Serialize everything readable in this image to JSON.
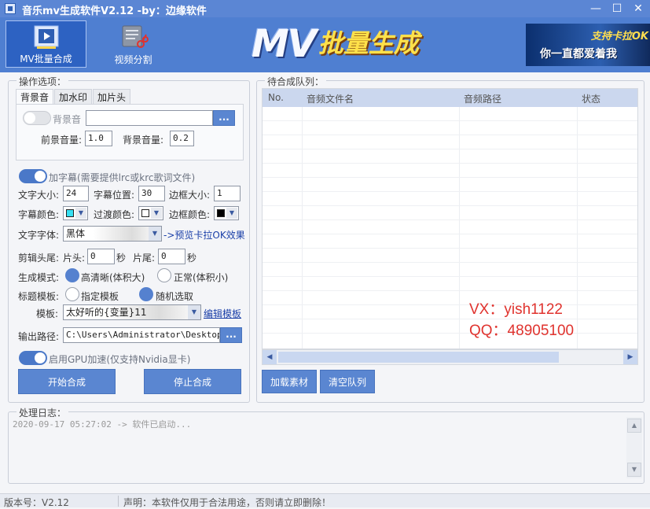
{
  "window": {
    "title": "音乐mv生成软件V2.12 -by：边缘软件",
    "controls": {
      "minimize": "—",
      "maximize": "☐",
      "close": "✕"
    }
  },
  "toolbar": {
    "items": [
      {
        "label": "MV批量合成",
        "icon": "film-icon",
        "active": true
      },
      {
        "label": "视频分割",
        "icon": "video-cut-icon",
        "active": false
      }
    ],
    "logo_mv": "MV",
    "logo_cn": "批量生成",
    "banner_line1": "支持卡拉OK",
    "banner_line2": "你一直都爱着我"
  },
  "options": {
    "group_title": "操作选项：",
    "tabs": [
      "背景音",
      "加水印",
      "加片头"
    ],
    "bgm": {
      "toggle_label": "背景音",
      "path_value": "",
      "browse_label": "...",
      "front_vol_label": "前景音量:",
      "front_vol_value": "1.0",
      "bg_vol_label": "背景音量:",
      "bg_vol_value": "0.2"
    },
    "subtitle": {
      "toggle_label": "加字幕(需要提供lrc或krc歌词文件)",
      "font_size_label": "文字大小:",
      "font_size_value": "24",
      "position_label": "字幕位置:",
      "position_value": "30",
      "border_size_label": "边框大小:",
      "border_size_value": "1",
      "sub_color_label": "字幕颜色:",
      "sub_color": "#36e0f2",
      "transition_color_label": "过渡颜色:",
      "transition_color": "#ffffff",
      "border_color_label": "边框颜色:",
      "border_color": "#000000",
      "font_label": "文字字体:",
      "font_value": "黑体",
      "preview_link": "->预览卡拉OK效果"
    },
    "trim": {
      "label": "剪辑头尾:",
      "head_label": "片头:",
      "head_value": "0",
      "head_unit": "秒",
      "tail_label": "片尾:",
      "tail_value": "0",
      "tail_unit": "秒"
    },
    "mode": {
      "label": "生成模式:",
      "hd_label": "高清晰(体积大)",
      "normal_label": "正常(体积小)"
    },
    "title_template": {
      "label": "标题模板:",
      "specified_label": "指定模板",
      "random_label": "随机选取"
    },
    "template": {
      "label": "模板:",
      "value": "太好听的{变量}11",
      "edit_link": "编辑模板"
    },
    "output": {
      "label": "输出路径:",
      "value": "C:\\Users\\Administrator\\Desktop\\d",
      "browse_label": "..."
    },
    "gpu_label": "启用GPU加速(仅支持Nvidia显卡)",
    "start_button": "开始合成",
    "stop_button": "停止合成"
  },
  "queue": {
    "group_title": "待合成队列：",
    "columns": [
      "No.",
      "音频文件名",
      "音频路径",
      "状态"
    ],
    "rows": [],
    "load_button": "加载素材",
    "clear_button": "清空队列"
  },
  "contact": {
    "vx": "VX：yish1122",
    "qq": "QQ：48905100"
  },
  "log": {
    "group_title": "处理日志：",
    "lines": [
      "2020-09-17 05:27:02 -> 软件已启动..."
    ]
  },
  "status": {
    "version": "版本号：V2.12",
    "notice": "声明：本软件仅用于合法用途，否则请立即删除！"
  }
}
